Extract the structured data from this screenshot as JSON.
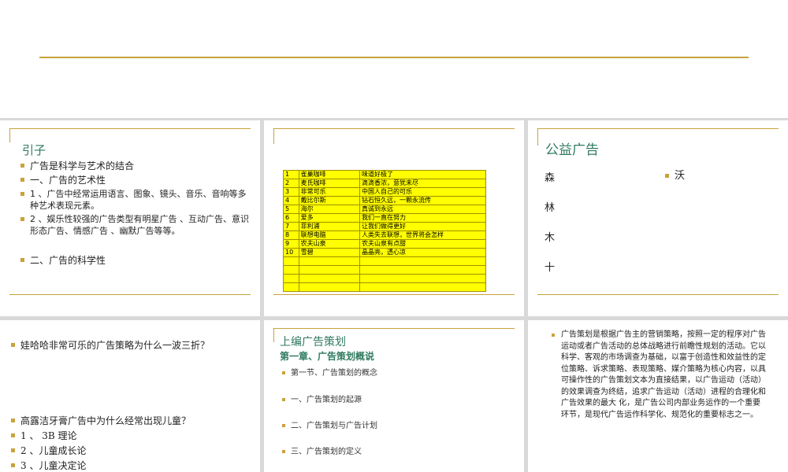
{
  "slide1": {
    "title": "引子",
    "bullets": [
      "广告是科学与艺术的结合",
      "一、广告的艺术性",
      "1 、广告中经常运用语言、图象、镜头、音乐、音响等多种艺术表现元素。",
      "2 、娱乐性较强的广告类型有明星广告 、互动广告、意识形态广告、情感广告 、幽默广告等等。",
      "二、广告的科学性"
    ]
  },
  "slide2": {
    "rows": [
      {
        "no": "1",
        "brand": "雀巢咖啡",
        "slogan": "味道好极了"
      },
      {
        "no": "2",
        "brand": "麦氏咖啡",
        "slogan": "滴滴香浓，意犹未尽"
      },
      {
        "no": "3",
        "brand": "非常可乐",
        "slogan": "中国人自己的可乐"
      },
      {
        "no": "4",
        "brand": "戴比尔斯",
        "slogan": "钻石恒久远，一颗永流传"
      },
      {
        "no": "5",
        "brand": "海尔",
        "slogan": "真诚到永远"
      },
      {
        "no": "6",
        "brand": "爱多",
        "slogan": "我们一直在努力"
      },
      {
        "no": "7",
        "brand": "菲利浦",
        "slogan": "让我们做得更好"
      },
      {
        "no": "8",
        "brand": "联想电脑",
        "slogan": "人类失去联想，世界将会怎样"
      },
      {
        "no": "9",
        "brand": "农夫山泉",
        "slogan": "农夫山泉有点甜"
      },
      {
        "no": "10",
        "brand": "雪碧",
        "slogan": "晶晶亮，透心凉"
      },
      {
        "no": "",
        "brand": "",
        "slogan": ""
      },
      {
        "no": "",
        "brand": "",
        "slogan": ""
      },
      {
        "no": "",
        "brand": "",
        "slogan": ""
      },
      {
        "no": "",
        "brand": "",
        "slogan": ""
      }
    ]
  },
  "slide3": {
    "title": "公益广告",
    "vertical_chars": [
      "森",
      "林",
      "木",
      "十"
    ],
    "bullet": "沃"
  },
  "slide4": {
    "bullets": [
      "娃哈哈非常可乐的广告策略为什么一波三折？",
      "高露洁牙膏广告中为什么经常出现儿童？",
      "1 、 3B 理论",
      "2 、儿童成长论",
      "3 、儿童决定论"
    ]
  },
  "slide5": {
    "title": "上编广告策划",
    "subtitle": "第一章、广告策划概说",
    "items": [
      "第一节、广告策划的概念",
      "一、广告策划的起源",
      "二、广告策划与广告计划",
      "三、广告策划的定义"
    ]
  },
  "slide6": {
    "paragraph": "广告策划是根据广告主的营销策略，按照一定的程序对广告运动或者广告活动的总体战略进行前瞻性规划的活动。它以科学、客观的市场调查为基础，以富于创造性和效益性的定位策略、诉求策略、表现策略、媒介策略为核心内容，以具可操作性的广告策划文本为直接结果，以广告运动（活动）的效果调查为终结，追求广告运动（活动）进程的合理化和广告效果的最大 化，是广告公司内部业务运作的一个重要环节，是现代广告运作科学化、规范化的重要标志之一。"
  }
}
